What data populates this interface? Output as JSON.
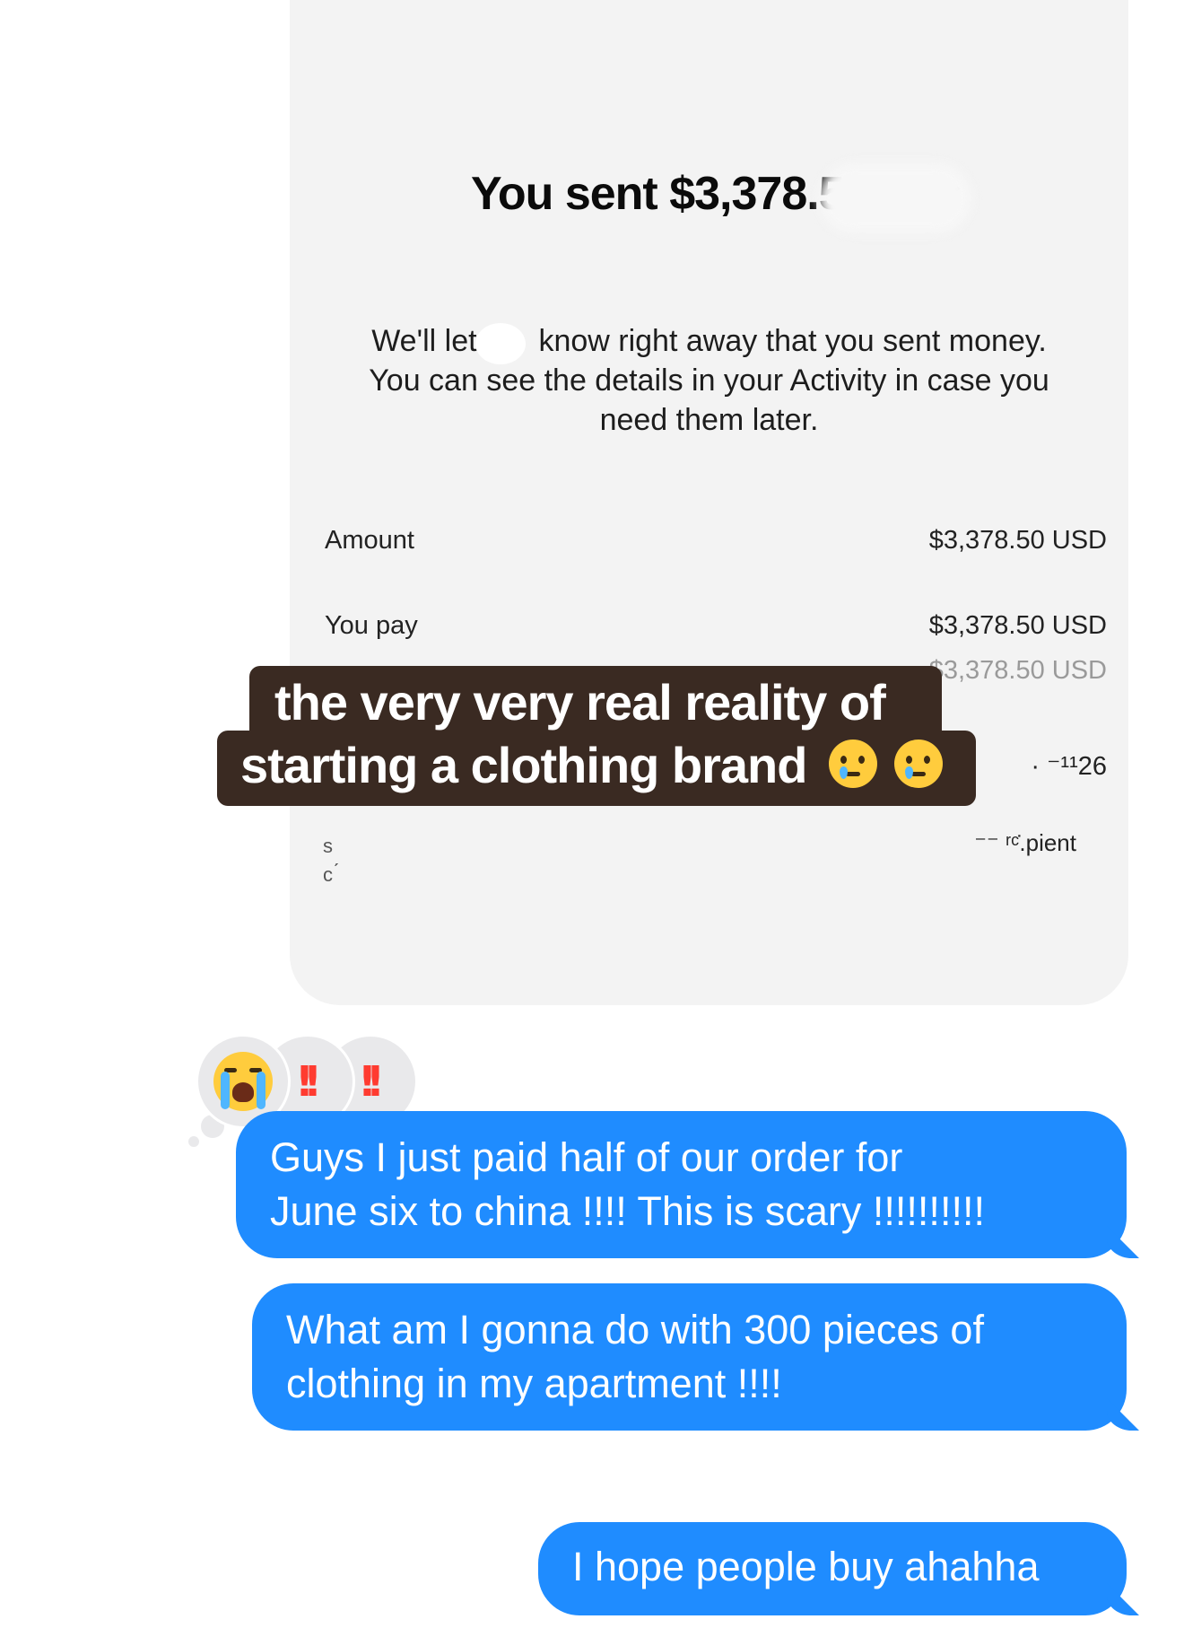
{
  "receipt": {
    "title": "You sent $3,378.50 to",
    "title_fragment": "ı̷",
    "desc_line1_a": "We'll let",
    "desc_line1_b": "know right away that you sent money.",
    "desc_line2": "You can see the details in your Activity in case you",
    "desc_line3": "need them later.",
    "rows": [
      {
        "label": "Amount",
        "value": "$3,378.50 USD"
      },
      {
        "label": "You pay",
        "value": "$3,378.50 USD"
      }
    ],
    "pay_method_partial": "$3,378.50 USD",
    "date_partial": "· ⁻¹¹26",
    "recipient_partial": "⁻⁻ ʳᶜ̇.pient",
    "left_partial_1": "s",
    "left_partial_2": "c ́"
  },
  "caption": {
    "line1": "the very very real reality of",
    "line2": "starting a clothing brand"
  },
  "reactions": [
    {
      "icon": "loudly-crying-face-icon"
    },
    {
      "icon": "double-exclamation-icon",
      "text": "!!"
    },
    {
      "icon": "double-exclamation-icon",
      "text": "!!"
    }
  ],
  "messages": [
    {
      "line1": "Guys I just paid half of our order for",
      "line2": "June six to china !!!! This is scary !!!!!!!!!!"
    },
    {
      "line1": "What am I gonna do with 300 pieces of",
      "line2": "clothing in my apartment !!!!"
    },
    {
      "line1": "I hope people buy ahahha"
    }
  ],
  "colors": {
    "bubble_blue": "#1f8cff",
    "caption_bg": "#3a2a22",
    "card_bg": "#f3f3f3",
    "reaction_bg": "#e9e9eb"
  }
}
